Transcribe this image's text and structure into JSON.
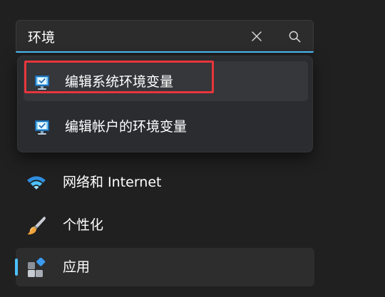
{
  "search": {
    "value": "环境",
    "clear_icon": "close-icon",
    "search_icon": "search-icon"
  },
  "suggestions": [
    {
      "label": "编辑系统环境变量",
      "icon": "system-properties-icon",
      "selected": true
    },
    {
      "label": "编辑帐户的环境变量",
      "icon": "system-properties-icon",
      "selected": false
    }
  ],
  "nav": {
    "items": [
      {
        "label": "网络和 Internet",
        "icon": "wifi-icon",
        "active": false
      },
      {
        "label": "个性化",
        "icon": "paintbrush-icon",
        "active": false
      },
      {
        "label": "应用",
        "icon": "apps-icon",
        "active": true
      }
    ]
  },
  "colors": {
    "accent": "#4cc2ff",
    "highlight_border": "#e8353b",
    "background": "#202020"
  }
}
